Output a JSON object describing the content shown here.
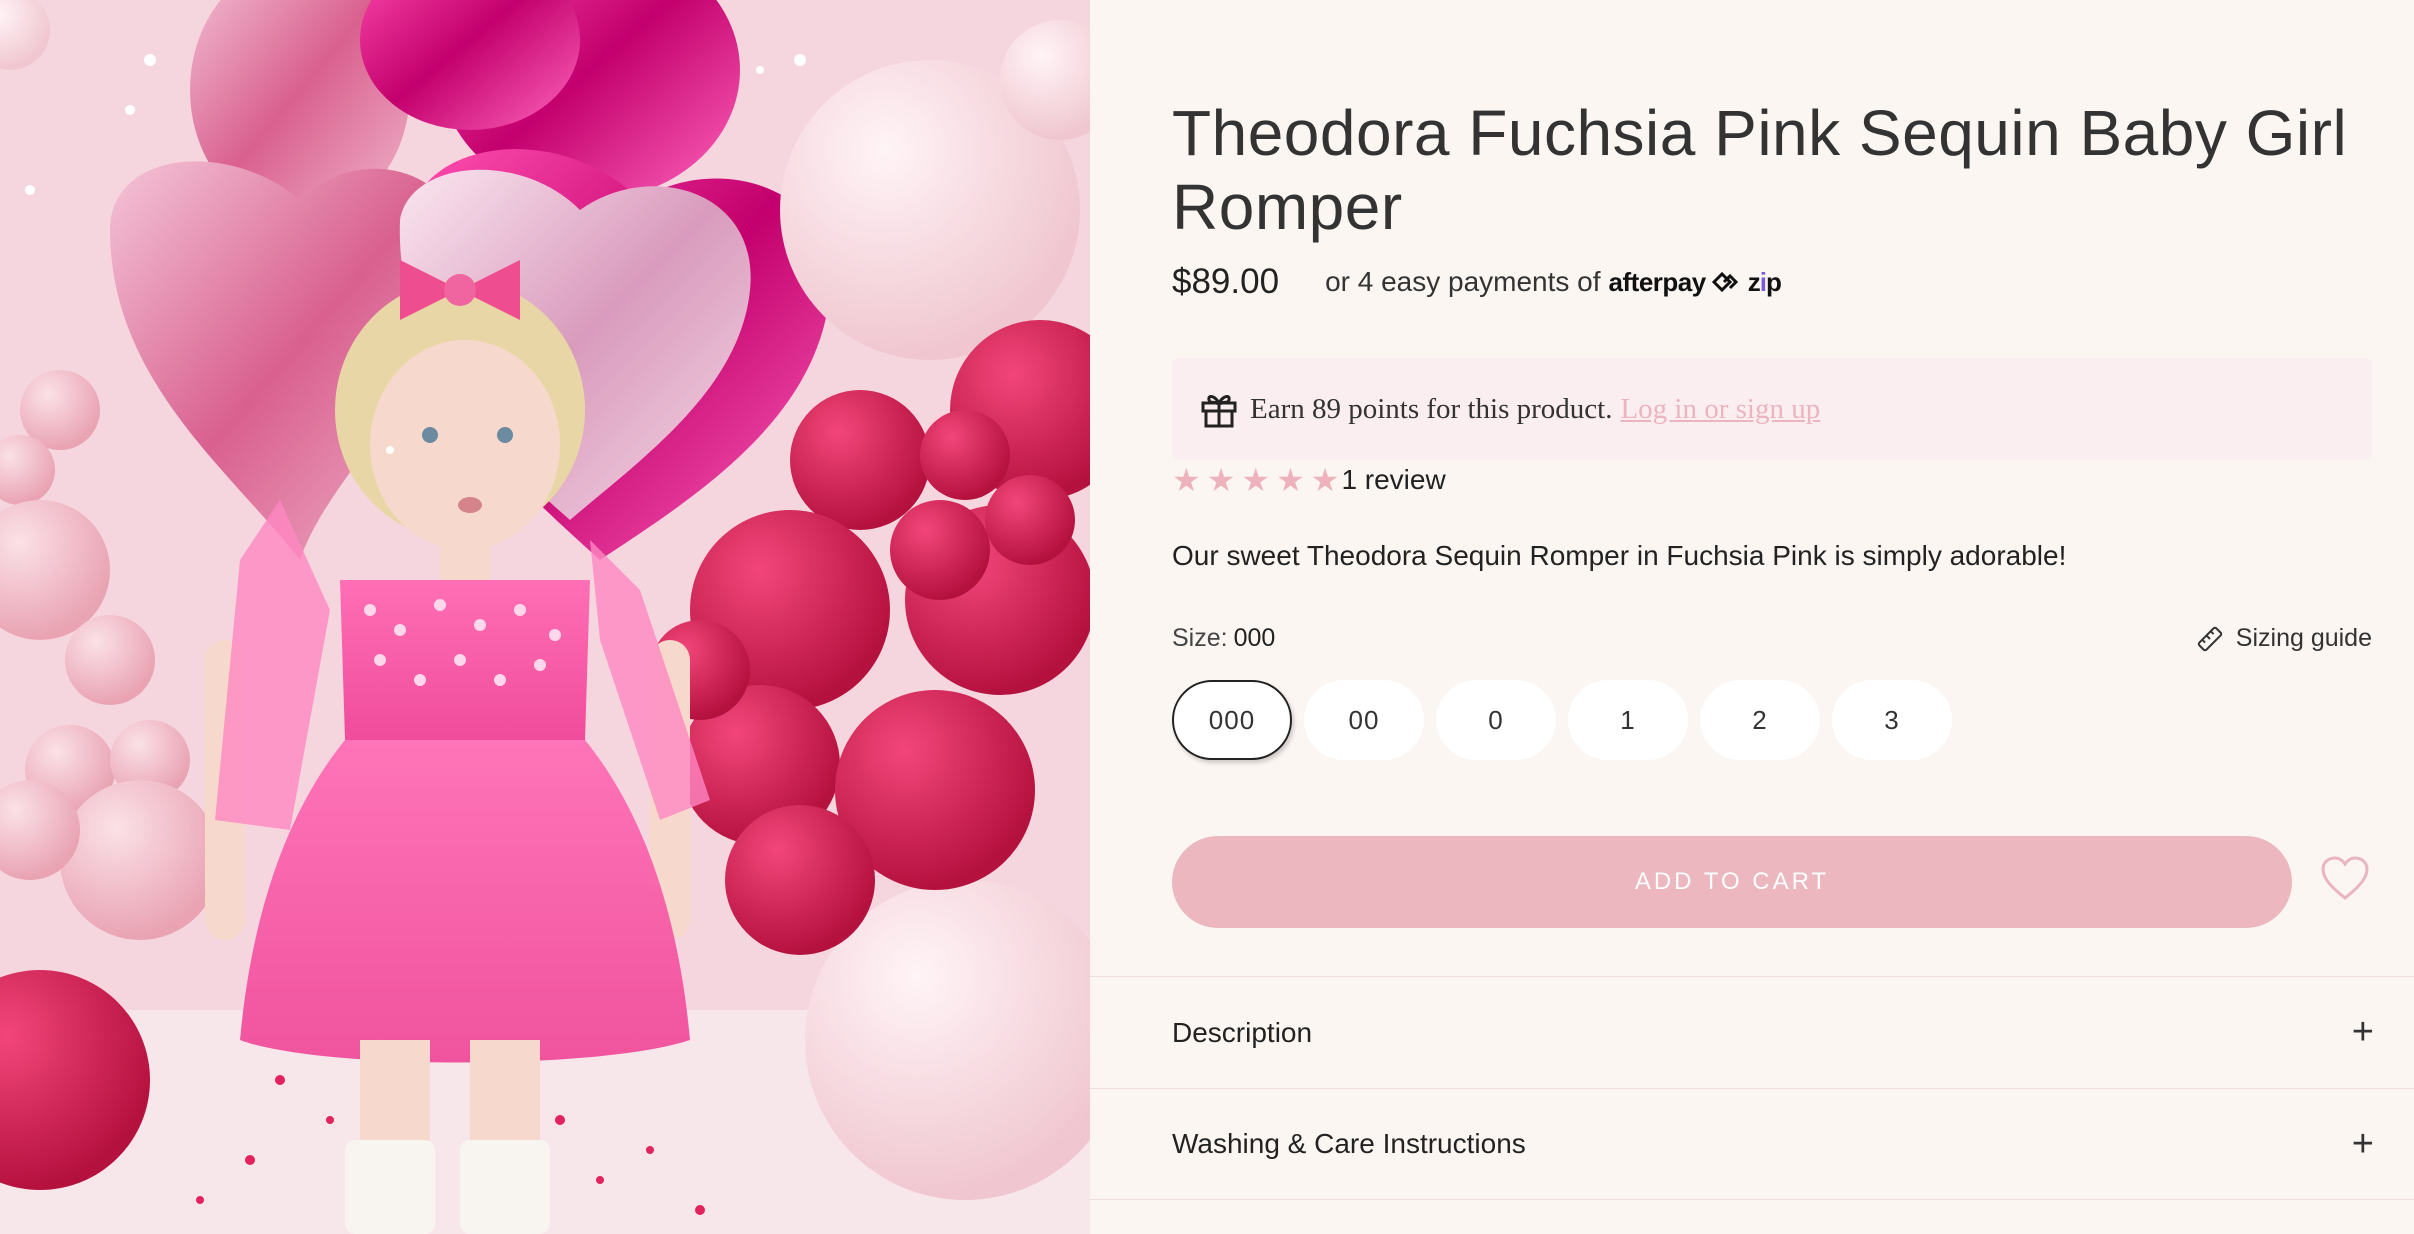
{
  "product": {
    "title": "Theodora Fuchsia Pink Sequin Baby Girl Romper",
    "price": "$89.00",
    "installments_text": "or 4 easy payments of",
    "afterpay_logo": "afterpay",
    "zip_logo": "zip",
    "rewards": {
      "text": "Earn 89 points for this product.",
      "link": "Log in or sign up",
      "icon": "gift-icon"
    },
    "rating": {
      "stars": 5,
      "max_stars": 5,
      "review_count": "1 review"
    },
    "tagline": "Our sweet Theodora Sequin Romper in Fuchsia Pink is simply adorable!",
    "size_label": "Size:",
    "selected_size": "000",
    "sizing_guide": "Sizing guide",
    "sizes": [
      "000",
      "00",
      "0",
      "1",
      "2",
      "3"
    ],
    "add_to_cart": "ADD TO CART"
  },
  "accordion": [
    {
      "label": "Description",
      "icon": "plus-icon"
    },
    {
      "label": "Washing & Care Instructions",
      "icon": "plus-icon"
    }
  ],
  "colors": {
    "background": "#fcf6f2",
    "accent_pink": "#ecb7bf",
    "rewards_bg": "#fbeef0",
    "star": "#eeb2bd",
    "zip_purple": "#7b5bd6"
  }
}
